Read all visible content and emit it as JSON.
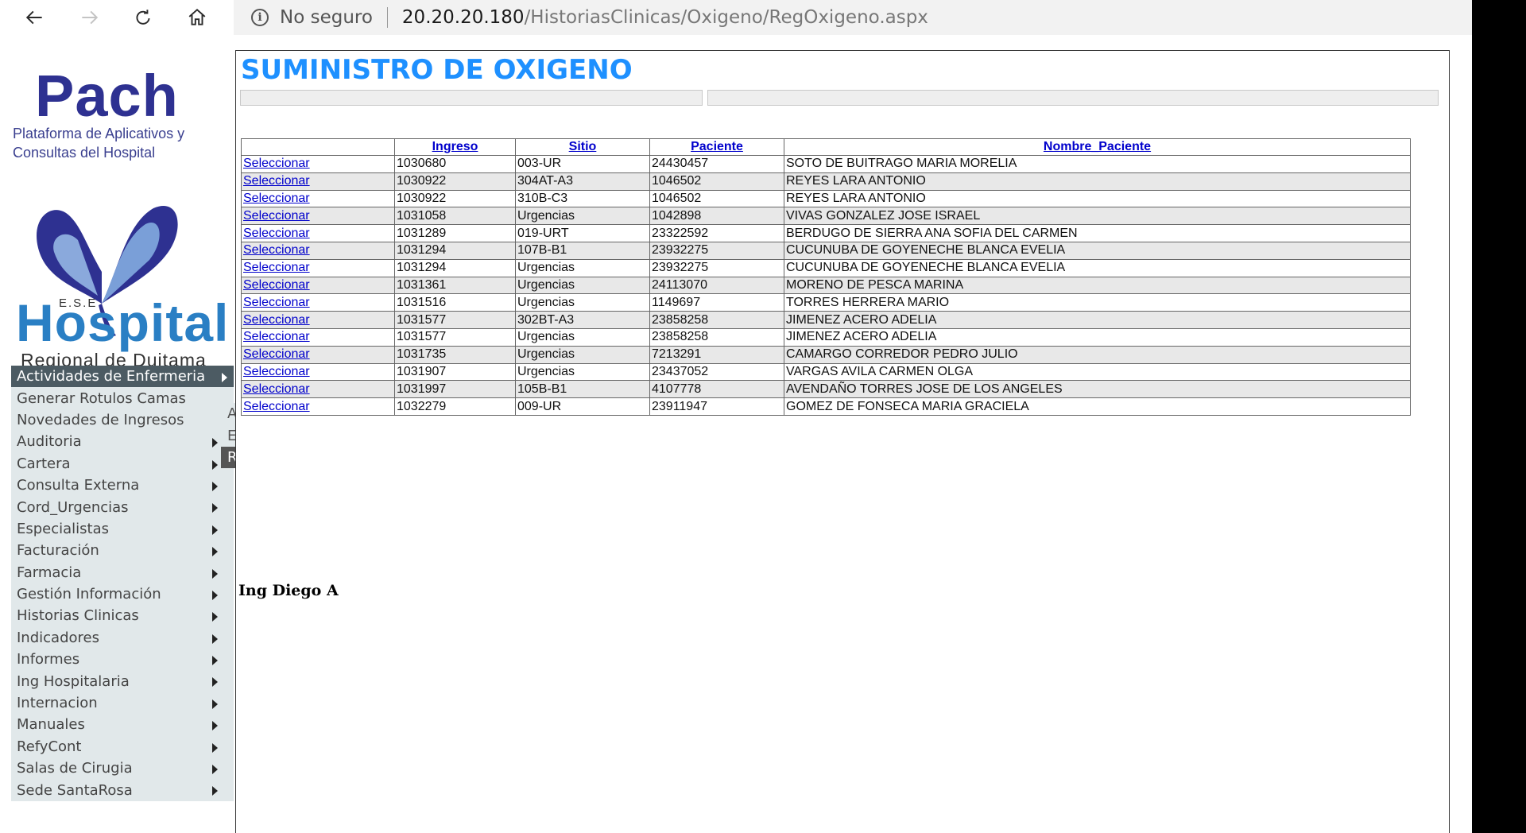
{
  "browser": {
    "security_text": "No seguro",
    "url_host": "20.20.20.180",
    "url_path": "/HistoriasClinicas/Oxigeno/RegOxigeno.aspx",
    "icons": [
      "back-icon",
      "forward-icon",
      "refresh-icon",
      "home-icon",
      "info-icon"
    ]
  },
  "logo": {
    "title": "Pach",
    "subtitle": "Plataforma de Aplicativos y Consultas del Hospital",
    "ese": "E.S.E",
    "hospital": "Hospital",
    "regional": "Regional de Duitama",
    "colors": {
      "pach": "#2e3191",
      "hospital": "#2a7fc4",
      "line": "#4a9a3a"
    }
  },
  "menu": {
    "items": [
      {
        "label": "Actividades de Enfermeria",
        "arrow": true,
        "active": true
      },
      {
        "label": "Generar Rotulos Camas",
        "arrow": false
      },
      {
        "label": "Novedades de Ingresos",
        "arrow": false
      },
      {
        "label": "Auditoria",
        "arrow": true
      },
      {
        "label": "Cartera",
        "arrow": true
      },
      {
        "label": "Consulta Externa",
        "arrow": true
      },
      {
        "label": "Cord_Urgencias",
        "arrow": true
      },
      {
        "label": "Especialistas",
        "arrow": true
      },
      {
        "label": "Facturación",
        "arrow": true
      },
      {
        "label": "Farmacia",
        "arrow": true
      },
      {
        "label": "Gestión Información",
        "arrow": true
      },
      {
        "label": "Historias Clinicas",
        "arrow": true
      },
      {
        "label": "Indicadores",
        "arrow": true
      },
      {
        "label": "Informes",
        "arrow": true
      },
      {
        "label": "Ing Hospitalaria",
        "arrow": true
      },
      {
        "label": "Internacion",
        "arrow": true
      },
      {
        "label": "Manuales",
        "arrow": true
      },
      {
        "label": "RefyCont",
        "arrow": true
      },
      {
        "label": "Salas de Cirugia",
        "arrow": true
      },
      {
        "label": "Sede SantaRosa",
        "arrow": true
      }
    ],
    "submenu": [
      {
        "label": "Actividades General",
        "active": false
      },
      {
        "label": "EKG-MAS",
        "active": false
      },
      {
        "label": "Registro Oxigeno",
        "active": true
      }
    ]
  },
  "main": {
    "title": "SUMINISTRO DE OXIGENO",
    "footer": "Ing Diego A",
    "table": {
      "headers": [
        "",
        "Ingreso",
        "Sitio",
        "Paciente",
        "Nombre_Paciente"
      ],
      "select_label": "Seleccionar",
      "rows": [
        [
          "1030680",
          "003-UR",
          "24430457",
          "SOTO DE BUITRAGO MARIA MORELIA"
        ],
        [
          "1030922",
          "304AT-A3",
          "1046502",
          "REYES LARA ANTONIO"
        ],
        [
          "1030922",
          "310B-C3",
          "1046502",
          "REYES LARA ANTONIO"
        ],
        [
          "1031058",
          "Urgencias",
          "1042898",
          "VIVAS GONZALEZ JOSE ISRAEL"
        ],
        [
          "1031289",
          "019-URT",
          "23322592",
          "BERDUGO DE SIERRA ANA SOFIA DEL CARMEN"
        ],
        [
          "1031294",
          "107B-B1",
          "23932275",
          "CUCUNUBA DE GOYENECHE BLANCA EVELIA"
        ],
        [
          "1031294",
          "Urgencias",
          "23932275",
          "CUCUNUBA DE GOYENECHE BLANCA EVELIA"
        ],
        [
          "1031361",
          "Urgencias",
          "24113070",
          "MORENO DE PESCA MARINA"
        ],
        [
          "1031516",
          "Urgencias",
          "1149697",
          "TORRES HERRERA MARIO"
        ],
        [
          "1031577",
          "302BT-A3",
          "23858258",
          "JIMENEZ ACERO ADELIA"
        ],
        [
          "1031577",
          "Urgencias",
          "23858258",
          "JIMENEZ ACERO ADELIA"
        ],
        [
          "1031735",
          "Urgencias",
          "7213291",
          "CAMARGO CORREDOR PEDRO JULIO"
        ],
        [
          "1031907",
          "Urgencias",
          "23437052",
          "VARGAS AVILA CARMEN OLGA"
        ],
        [
          "1031997",
          "105B-B1",
          "4107778",
          "AVENDAÑO TORRES JOSE DE LOS ANGELES"
        ],
        [
          "1032279",
          "009-UR",
          "23911947",
          "GOMEZ DE FONSECA MARIA GRACIELA"
        ]
      ]
    }
  }
}
